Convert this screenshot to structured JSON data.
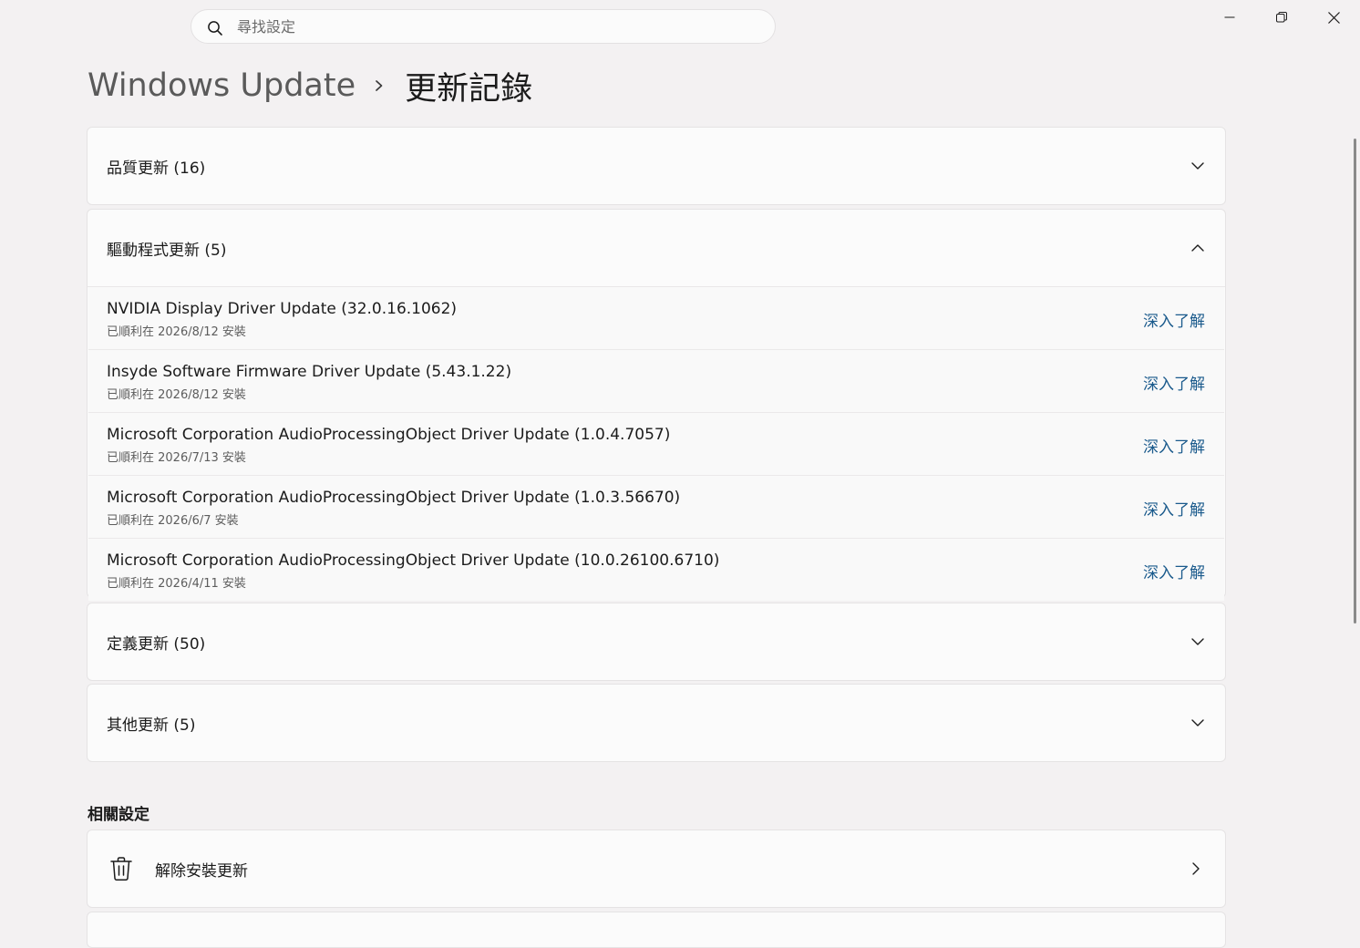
{
  "search": {
    "placeholder": "尋找設定"
  },
  "window_controls": {
    "minimize_icon": "minimize-icon",
    "restore_icon": "restore-icon",
    "close_icon": "close-icon"
  },
  "breadcrumb": {
    "parent": "Windows Update",
    "current": "更新記錄"
  },
  "sections": {
    "quality": {
      "label": "品質更新 (16)",
      "expanded": false
    },
    "driver": {
      "label": "驅動程式更新 (5)",
      "expanded": true,
      "items": [
        {
          "title": "NVIDIA Display Driver Update (32.0.16.1062)",
          "status": "已順利在 2026/8/12 安裝",
          "link": "深入了解"
        },
        {
          "title": "Insyde Software Firmware Driver Update (5.43.1.22)",
          "status": "已順利在 2026/8/12 安裝",
          "link": "深入了解"
        },
        {
          "title": "Microsoft Corporation AudioProcessingObject Driver Update (1.0.4.7057)",
          "status": "已順利在 2026/7/13 安裝",
          "link": "深入了解"
        },
        {
          "title": "Microsoft Corporation AudioProcessingObject Driver Update (1.0.3.56670)",
          "status": "已順利在 2026/6/7 安裝",
          "link": "深入了解"
        },
        {
          "title": "Microsoft Corporation AudioProcessingObject Driver Update (10.0.26100.6710)",
          "status": "已順利在 2026/4/11 安裝",
          "link": "深入了解"
        }
      ]
    },
    "definition": {
      "label": "定義更新 (50)",
      "expanded": false
    },
    "other": {
      "label": "其他更新 (5)",
      "expanded": false
    }
  },
  "related": {
    "title": "相關設定",
    "uninstall": {
      "label": "解除安裝更新",
      "icon": "trash-icon"
    }
  },
  "colors": {
    "background": "#f3f1f2",
    "card": "#fbfbfb",
    "link": "#1a5a8c"
  }
}
